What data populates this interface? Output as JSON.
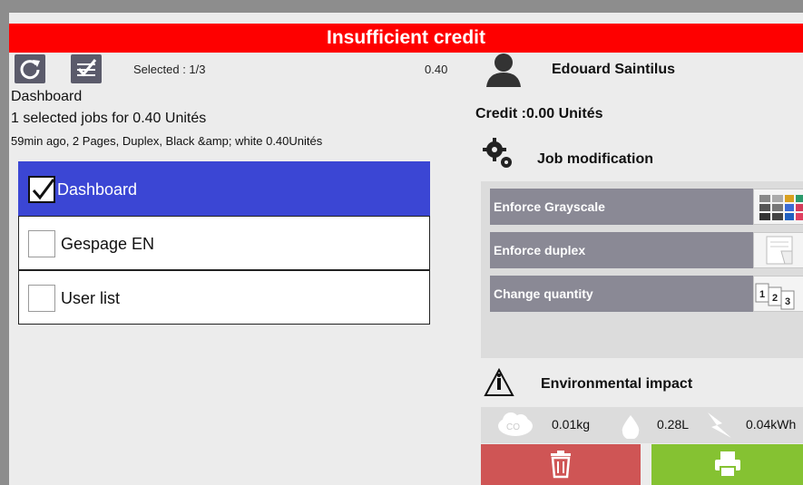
{
  "header": {
    "title": "Insufficient credit"
  },
  "toolbar": {
    "refresh_icon": "refresh-icon",
    "select_all_icon": "select-all-icon",
    "selected_label": "Selected : 1/3",
    "selected_value": "0.40"
  },
  "job_info": {
    "destination": "Dashboard",
    "summary": "1 selected jobs for 0.40 Unités",
    "details": "59min ago,  2 Pages,  Duplex,  Black &amp; white  0.40Unités"
  },
  "destinations": [
    {
      "label": "Dashboard",
      "checked": true
    },
    {
      "label": "Gespage EN",
      "checked": false
    },
    {
      "label": "User list",
      "checked": false
    }
  ],
  "user": {
    "name": "Edouard Saintilus",
    "credit": "Credit :0.00 Unités"
  },
  "job_modification": {
    "title": "Job modification",
    "options": [
      {
        "label": "Enforce Grayscale",
        "icon": "grayscale-icon"
      },
      {
        "label": "Enforce duplex",
        "icon": "duplex-icon"
      },
      {
        "label": "Change quantity",
        "icon": "quantity-icon"
      }
    ]
  },
  "environmental_impact": {
    "title": "Environmental impact",
    "co2": "0.01kg",
    "water": "0.28L",
    "energy": "0.04kWh"
  },
  "actions": {
    "delete_icon": "trash-icon",
    "print_icon": "printer-icon"
  },
  "colors": {
    "header": "#fe0000",
    "selected": "#3b46d4",
    "delete": "#cf5555",
    "print": "#85c232",
    "option": "#8a8995"
  }
}
